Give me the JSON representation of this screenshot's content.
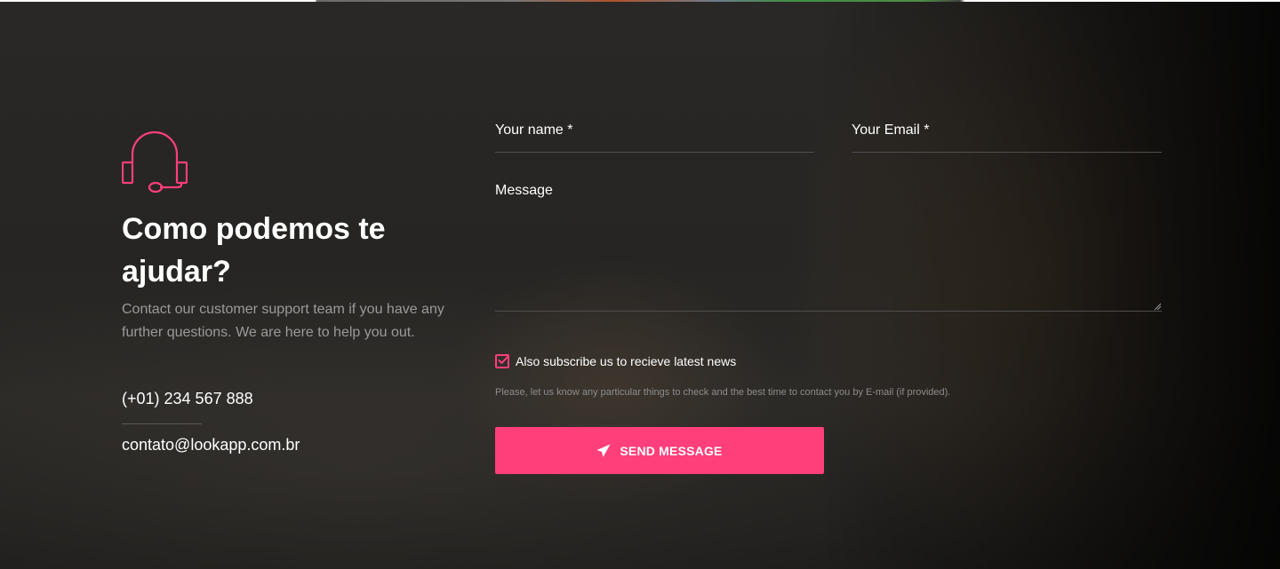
{
  "colors": {
    "accent": "#ff3f7a",
    "text": "#ffffff",
    "muted": "#9a9a9a"
  },
  "intro": {
    "icon": "headset-icon",
    "title": "Como podemos te ajudar?",
    "description": "Contact our customer support team if you have any further questions. We are here to help you out."
  },
  "contact": {
    "phone": "(+01) 234 567 888",
    "email": "contato@lookapp.com.br"
  },
  "form": {
    "name_label": "Your name *",
    "email_label": "Your Email *",
    "message_label": "Message",
    "subscribe": {
      "label": "Also subscribe us to recieve latest news",
      "checked": true
    },
    "note": "Please, let us know any particular things to check and the best time to contact you by E-mail (if provided).",
    "submit_label": "SEND MESSAGE",
    "submit_icon": "send-icon"
  }
}
